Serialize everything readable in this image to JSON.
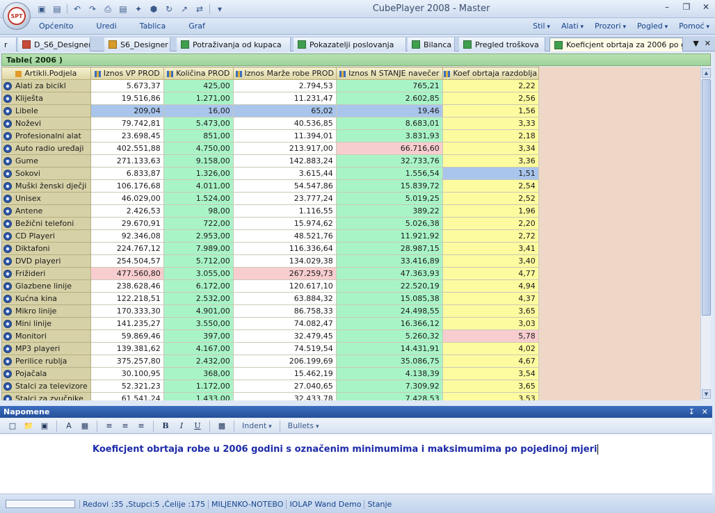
{
  "app": {
    "title": "CubePlayer 2008 - Master",
    "logo_text": "SPT"
  },
  "menu": {
    "left": [
      "Općenito",
      "Uredi",
      "Tablica",
      "Graf"
    ],
    "right": [
      "Stil",
      "Alati",
      "Prozori",
      "Pogled",
      "Pomoć"
    ]
  },
  "tabs": [
    {
      "label": "r",
      "icon": "",
      "active": false
    },
    {
      "label": "D_S6_Designer",
      "icon": "red",
      "active": false
    },
    {
      "label": "S6_Designer",
      "icon": "design",
      "active": false
    },
    {
      "label": "Potraživanja od kupaca",
      "icon": "green",
      "active": false
    },
    {
      "label": "Pokazatelji poslovanja",
      "icon": "green",
      "active": false
    },
    {
      "label": "Bilanca",
      "icon": "green",
      "active": false
    },
    {
      "label": "Pregled troškova",
      "icon": "green",
      "active": false
    },
    {
      "label": "Koeficjent obrtaja za 2006 po g...",
      "icon": "green",
      "active": true
    }
  ],
  "table": {
    "title": "Table( 2006 )",
    "columns": [
      "Artikli.Podjela",
      "Iznos VP PROD",
      "Količina PROD",
      "Iznos Marže robe PROD",
      "Iznos N STANJE navečer",
      "Koef obrtaja razdoblja"
    ],
    "column_colors": [
      "",
      "white",
      "green",
      "white",
      "green",
      "yellow"
    ],
    "rows": [
      {
        "name": "Alati za bicikl",
        "values": [
          "5.673,37",
          "425,00",
          "2.794,53",
          "765,21",
          "2,22"
        ],
        "highlight": {}
      },
      {
        "name": "Kliješta",
        "values": [
          "19.516,86",
          "1.271,00",
          "11.231,47",
          "2.602,85",
          "2,56"
        ],
        "highlight": {}
      },
      {
        "name": "Libele",
        "values": [
          "209,04",
          "16,00",
          "65,02",
          "19,46",
          "1,56"
        ],
        "highlight": {
          "0": "blue",
          "1": "blue",
          "2": "blue",
          "3": "blue"
        }
      },
      {
        "name": "Noževi",
        "values": [
          "79.742,81",
          "5.473,00",
          "40.536,85",
          "8.683,01",
          "3,33"
        ],
        "highlight": {}
      },
      {
        "name": "Profesionalni alat",
        "values": [
          "23.698,45",
          "851,00",
          "11.394,01",
          "3.831,93",
          "2,18"
        ],
        "highlight": {}
      },
      {
        "name": "Auto radio uređaji",
        "values": [
          "402.551,88",
          "4.750,00",
          "213.917,00",
          "66.716,60",
          "3,34"
        ],
        "highlight": {
          "3": "pink"
        }
      },
      {
        "name": "Gume",
        "values": [
          "271.133,63",
          "9.158,00",
          "142.883,24",
          "32.733,76",
          "3,36"
        ],
        "highlight": {}
      },
      {
        "name": "Sokovi",
        "values": [
          "6.833,87",
          "1.326,00",
          "3.615,44",
          "1.556,54",
          "1,51"
        ],
        "highlight": {
          "4": "blue"
        }
      },
      {
        "name": "Muški ženski dječji",
        "values": [
          "106.176,68",
          "4.011,00",
          "54.547,86",
          "15.839,72",
          "2,54"
        ],
        "highlight": {}
      },
      {
        "name": "Unisex",
        "values": [
          "46.029,00",
          "1.524,00",
          "23.777,24",
          "5.019,25",
          "2,52"
        ],
        "highlight": {}
      },
      {
        "name": "Antene",
        "values": [
          "2.426,53",
          "98,00",
          "1.116,55",
          "389,22",
          "1,96"
        ],
        "highlight": {}
      },
      {
        "name": "Bežični telefoni",
        "values": [
          "29.670,91",
          "722,00",
          "15.974,62",
          "5.026,38",
          "2,20"
        ],
        "highlight": {}
      },
      {
        "name": "CD Playeri",
        "values": [
          "92.346,08",
          "2.953,00",
          "48.521,76",
          "11.921,92",
          "2,72"
        ],
        "highlight": {}
      },
      {
        "name": "Diktafoni",
        "values": [
          "224.767,12",
          "7.989,00",
          "116.336,64",
          "28.987,15",
          "3,41"
        ],
        "highlight": {}
      },
      {
        "name": "DVD playeri",
        "values": [
          "254.504,57",
          "5.712,00",
          "134.029,38",
          "33.416,89",
          "3,40"
        ],
        "highlight": {}
      },
      {
        "name": "Frižideri",
        "values": [
          "477.560,80",
          "3.055,00",
          "267.259,73",
          "47.363,93",
          "4,77"
        ],
        "highlight": {
          "0": "pink",
          "2": "pink"
        }
      },
      {
        "name": "Glazbene linije",
        "values": [
          "238.628,46",
          "6.172,00",
          "120.617,10",
          "22.520,19",
          "4,94"
        ],
        "highlight": {}
      },
      {
        "name": "Kućna kina",
        "values": [
          "122.218,51",
          "2.532,00",
          "63.884,32",
          "15.085,38",
          "4,37"
        ],
        "highlight": {}
      },
      {
        "name": "Mikro linije",
        "values": [
          "170.333,30",
          "4.901,00",
          "86.758,33",
          "24.498,55",
          "3,65"
        ],
        "highlight": {}
      },
      {
        "name": "Mini linije",
        "values": [
          "141.235,27",
          "3.550,00",
          "74.082,47",
          "16.366,12",
          "3,03"
        ],
        "highlight": {}
      },
      {
        "name": "Monitori",
        "values": [
          "59.869,46",
          "397,00",
          "32.479,45",
          "5.260,32",
          "5,78"
        ],
        "highlight": {
          "4": "pink"
        }
      },
      {
        "name": "MP3 playeri",
        "values": [
          "139.381,62",
          "4.167,00",
          "74.519,54",
          "14.431,91",
          "4,02"
        ],
        "highlight": {}
      },
      {
        "name": "Perilice rublja",
        "values": [
          "375.257,80",
          "2.432,00",
          "206.199,69",
          "35.086,75",
          "4,67"
        ],
        "highlight": {}
      },
      {
        "name": "Pojačala",
        "values": [
          "30.100,95",
          "368,00",
          "15.462,19",
          "4.138,39",
          "3,54"
        ],
        "highlight": {}
      },
      {
        "name": "Stalci za televizore",
        "values": [
          "52.321,23",
          "1.172,00",
          "27.040,65",
          "7.309,92",
          "3,65"
        ],
        "highlight": {}
      },
      {
        "name": "Stalci za zvučnike",
        "values": [
          "61.541,24",
          "1.433,00",
          "32.433,78",
          "7.428,53",
          "3,53"
        ],
        "highlight": {}
      }
    ]
  },
  "notes": {
    "title": "Napomene",
    "indent_label": "Indent",
    "bullets_label": "Bullets",
    "text": "Koeficjent obrtaja robe u 2006 godini s označenim minimumima i maksimumima po pojedinoj mjeri"
  },
  "status": {
    "items": [
      "Redovi :35 ,Stupci:5 ,Ćelije :175",
      "MILJENKO-NOTEBO",
      "IOLAP Wand Demo",
      "Stanje"
    ]
  }
}
